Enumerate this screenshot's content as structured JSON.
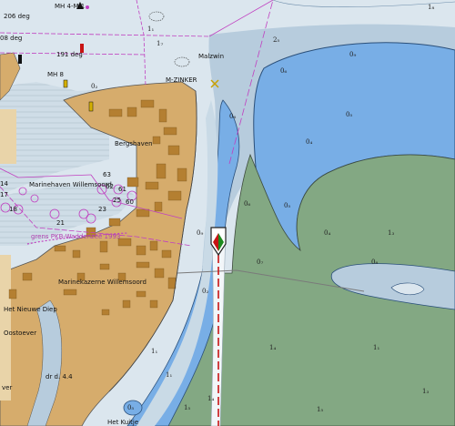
{
  "colors": {
    "land": "#d6ac6c",
    "deep_water": "#dbe6ee",
    "mid_water": "#b7ccdd",
    "shallow_water": "#78aee6",
    "drying": "#83a883",
    "harbour_hatch": "#cfdde7",
    "magenta": "#c040c0",
    "fairway_red": "#c81414"
  },
  "icons": [
    "light-beacon-icon",
    "ship-icon",
    "wreck-icon",
    "buoy-icon"
  ],
  "labels": {
    "mh_4m1": "MH 4-M 1",
    "deg_206": "206 deg",
    "deg_208": "08 deg",
    "deg_191": "191 deg",
    "mh8": "MH 8",
    "malzwin": "Malzwin",
    "mzinker": "M-ZINKER",
    "bergshaven": "Bergshaven",
    "marinehaven": "Marinehaven Willemsoord",
    "grens": "grens PKB-Waddenzee 1993",
    "marinekazerne": "Marinekazerne Willemsoord",
    "nieuwe_diep": "Het Nieuwe Diep",
    "oostoever": "Oostoever",
    "drd": "dr d. 4.4",
    "kuitje": "Het Kuitje",
    "over": "ver"
  },
  "berth_numbers": [
    "63",
    "62",
    "61",
    "60",
    "25",
    "23",
    "21",
    "14",
    "17",
    "18"
  ],
  "depths": [
    {
      "t": "0₂",
      "k": "d1"
    },
    {
      "t": "0₉",
      "k": "d2"
    },
    {
      "t": "0₆",
      "k": "d3"
    },
    {
      "t": "0₅",
      "k": "d4"
    },
    {
      "t": "0₆",
      "k": "d5"
    },
    {
      "t": "0₄",
      "k": "d6"
    },
    {
      "t": "0₆",
      "k": "d7"
    },
    {
      "t": "0₅",
      "k": "d8"
    },
    {
      "t": "0₄",
      "k": "d9"
    },
    {
      "t": "1₃",
      "k": "d10"
    },
    {
      "t": "0₉",
      "k": "d11"
    },
    {
      "t": "0₇",
      "k": "d12"
    },
    {
      "t": "0₈",
      "k": "d13"
    },
    {
      "t": "0₂",
      "k": "d14"
    },
    {
      "t": "1₁",
      "k": "d15"
    },
    {
      "t": "1₄",
      "k": "d16"
    },
    {
      "t": "1₁",
      "k": "d17"
    },
    {
      "t": "1₁",
      "k": "d18"
    },
    {
      "t": "1₅",
      "k": "d19"
    },
    {
      "t": "1₅",
      "k": "d20"
    },
    {
      "t": "1₄",
      "k": "d21"
    },
    {
      "t": "1₃",
      "k": "d22"
    },
    {
      "t": "0₅",
      "k": "d23"
    },
    {
      "t": "1₈",
      "k": "d24"
    },
    {
      "t": "1₁",
      "k": "d25"
    },
    {
      "t": "2₅",
      "k": "d26"
    },
    {
      "t": "1₇",
      "k": "d27"
    }
  ]
}
